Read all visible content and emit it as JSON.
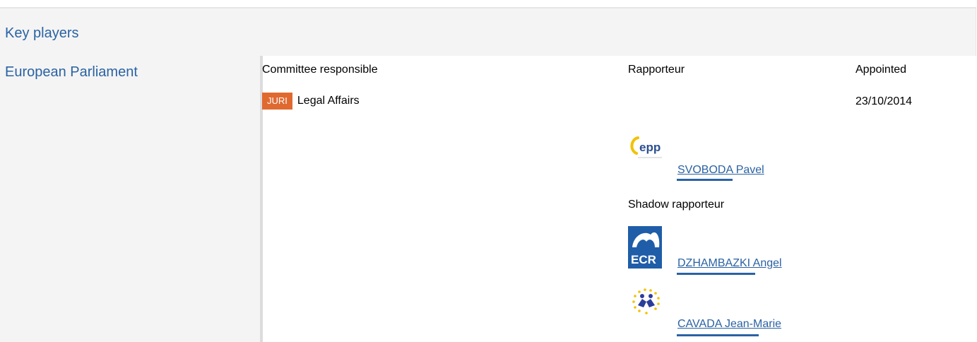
{
  "panel": {
    "title": "Key players"
  },
  "institution": {
    "name": "European Parliament"
  },
  "headers": {
    "committee": "Committee responsible",
    "rapporteur": "Rapporteur",
    "appointed": "Appointed"
  },
  "committee": {
    "badge": "JURI",
    "name": "Legal Affairs",
    "appointed": "23/10/2014",
    "badge_color": "#e06930"
  },
  "rapporteur": {
    "name": "SVOBODA Pavel",
    "group_icon": "epp-logo-icon"
  },
  "shadow_label": "Shadow rapporteur",
  "shadow_rapporteurs": [
    {
      "name": "DZHAMBAZKI Angel",
      "group_icon": "ecr-logo-icon"
    },
    {
      "name": "CAVADA Jean-Marie",
      "group_icon": "alde-logo-icon"
    }
  ],
  "colors": {
    "link": "#2a62a3",
    "panel_bg": "#f4f4f4"
  }
}
